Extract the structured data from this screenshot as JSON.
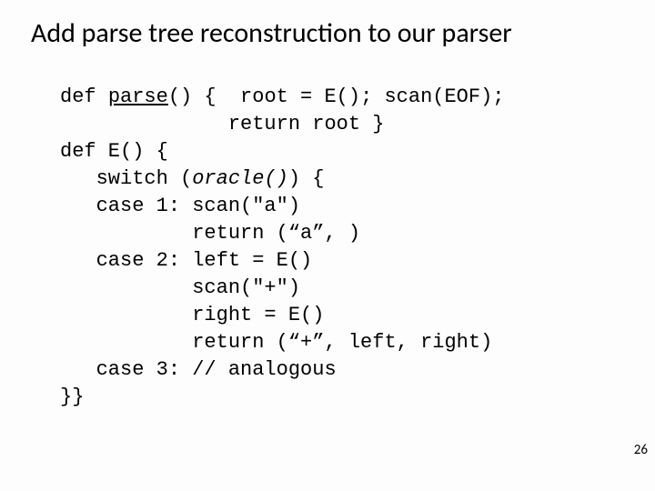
{
  "title": "Add parse tree reconstruction to our parser",
  "code": {
    "l1a": "def ",
    "l1b": "parse",
    "l1c": "() {  root = E(); scan(EOF);",
    "l2": "              return root }",
    "l3": "def E() {",
    "l4a": "   switch (",
    "l4b": "oracle()",
    "l4c": ") {",
    "l5": "   case 1: scan(\"a\")",
    "l6": "           return (“a”, )",
    "l7": "   case 2: left = E()",
    "l8": "           scan(\"+\")",
    "l9": "           right = E()",
    "l10": "           return (“+”, left, right)",
    "l11": "   case 3: // analogous",
    "l12": "}}"
  },
  "pagenum": "26"
}
